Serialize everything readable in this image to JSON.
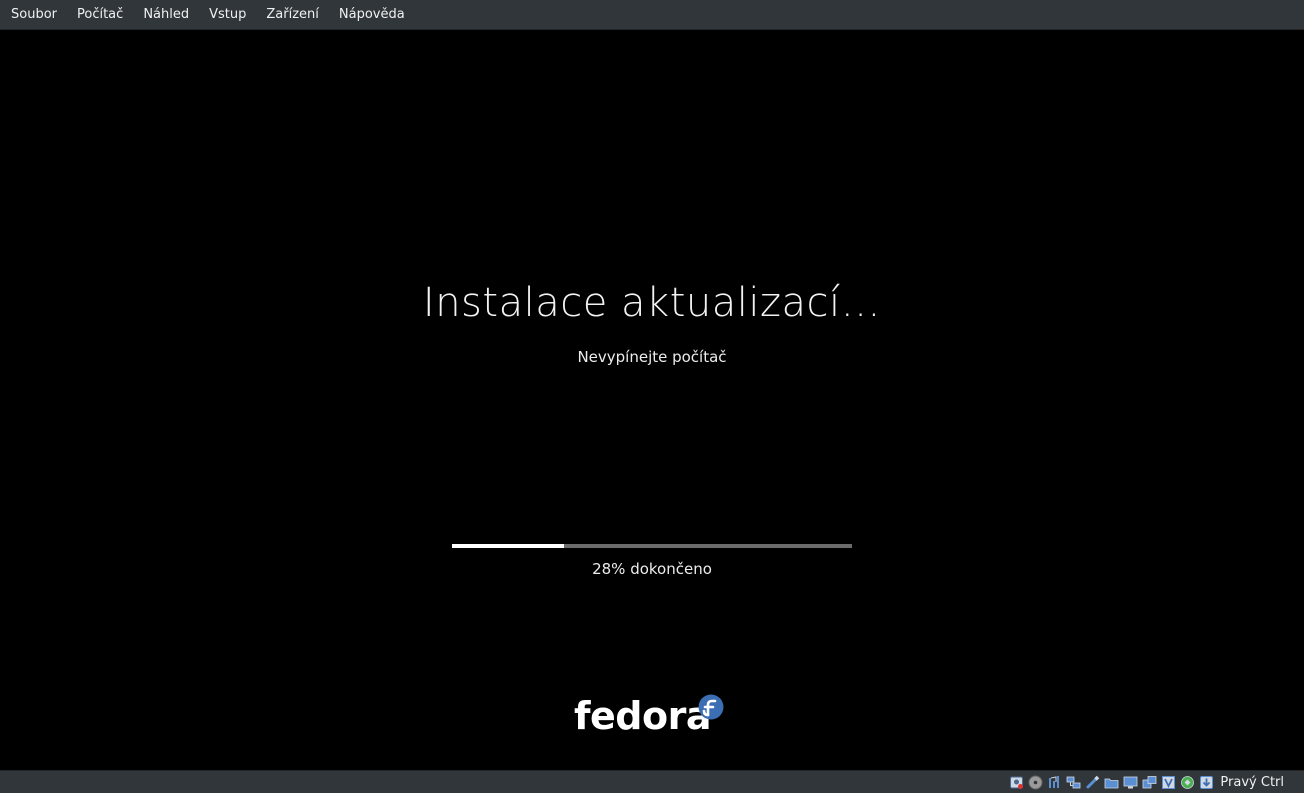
{
  "menubar": {
    "items": [
      {
        "label": "Soubor"
      },
      {
        "label": "Počítač"
      },
      {
        "label": "Náhled"
      },
      {
        "label": "Vstup"
      },
      {
        "label": "Zařízení"
      },
      {
        "label": "Nápověda"
      }
    ]
  },
  "screen": {
    "title": "Instalace aktualizací…",
    "subtitle": "Nevypínejte počítač",
    "progress_fraction": 0.28,
    "progress_text": "28% dokončeno",
    "logo_text": "fedora"
  },
  "statusbar": {
    "icons": [
      "hard-disk-icon",
      "optical-drive-icon",
      "audio-icon",
      "network-icon",
      "usb-icon",
      "shared-folders-icon",
      "display-icon",
      "video-capture-icon",
      "virtualization-icon",
      "mouse-integration-icon",
      "keyboard-icon"
    ],
    "host_key": "Pravý Ctrl"
  },
  "colors": {
    "menubar_bg": "#31363b",
    "screen_bg": "#000000",
    "progress_fill": "#ffffff",
    "progress_track": "#6b6b6b",
    "fedora_blue": "#3c6eb4"
  }
}
